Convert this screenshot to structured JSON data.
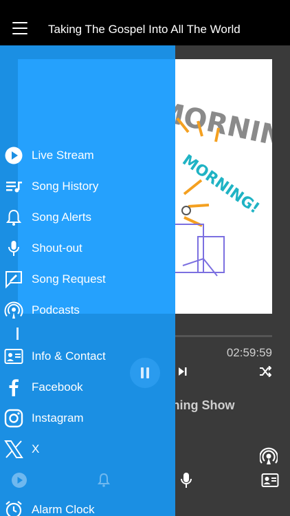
{
  "header": {
    "title": "Taking The Gospel Into All The World"
  },
  "artwork": {
    "line1": "GOOD MORNING",
    "line2": "MORNING GOOD MORNING!"
  },
  "player": {
    "time_remaining": "02:59:59",
    "show_title": "This is The Day Morning Show"
  },
  "menu": {
    "items": [
      {
        "label": "Live Stream",
        "icon": "play-circle-icon"
      },
      {
        "label": "Song History",
        "icon": "song-history-icon"
      },
      {
        "label": "Song Alerts",
        "icon": "bell-icon"
      },
      {
        "label": "Shout-out",
        "icon": "microphone-icon"
      },
      {
        "label": "Song Request",
        "icon": "request-icon"
      },
      {
        "label": "Podcasts",
        "icon": "podcast-icon"
      },
      {
        "label": "Info & Contact",
        "icon": "contact-card-icon"
      },
      {
        "label": "Facebook",
        "icon": "facebook-icon"
      },
      {
        "label": "Instagram",
        "icon": "instagram-icon"
      },
      {
        "label": "X",
        "icon": "x-icon"
      },
      {
        "label": "Alarm Clock",
        "icon": "alarm-clock-icon"
      }
    ]
  },
  "colors": {
    "drawer": "#1b8fe3",
    "overlay": "#27a3ff",
    "topbar": "#000000",
    "player_bg": "#3a3a3a"
  }
}
